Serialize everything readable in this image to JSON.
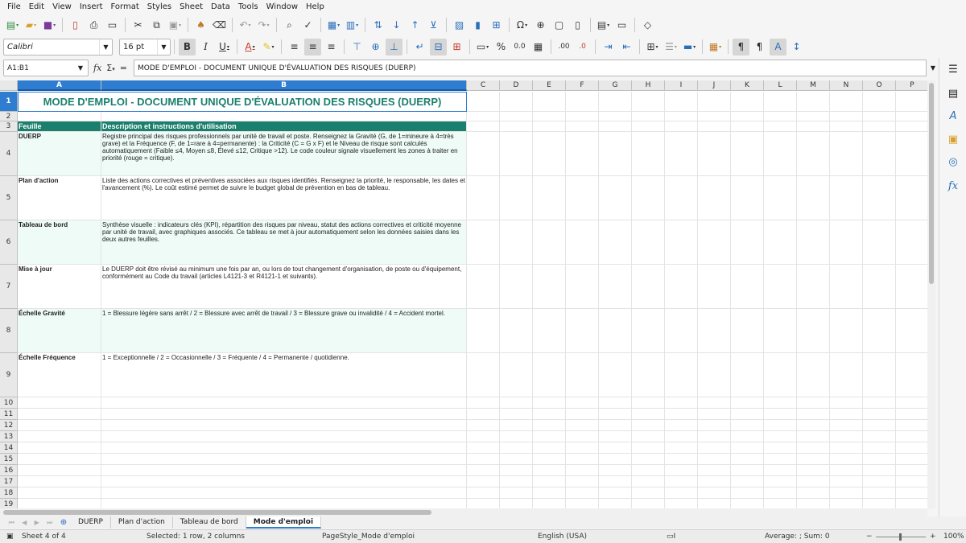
{
  "menu": [
    "File",
    "Edit",
    "View",
    "Insert",
    "Format",
    "Styles",
    "Sheet",
    "Data",
    "Tools",
    "Window",
    "Help"
  ],
  "toolbar2": {
    "font_name": "Calibri",
    "font_size": "16 pt"
  },
  "formula": {
    "name_box": "A1:B1",
    "content": "MODE D'EMPLOI - DOCUMENT UNIQUE D'ÉVALUATION DES RISQUES (DUERP)"
  },
  "columns": [
    "A",
    "B",
    "C",
    "D",
    "E",
    "F",
    "G",
    "H",
    "I",
    "J",
    "K",
    "L",
    "M",
    "N",
    "O",
    "P"
  ],
  "rows": [
    "1",
    "2",
    "3",
    "4",
    "5",
    "6",
    "7",
    "8",
    "9",
    "10",
    "11",
    "12",
    "13",
    "14",
    "15",
    "16",
    "17",
    "18",
    "19"
  ],
  "sheet": {
    "title": "MODE D'EMPLOI - DOCUMENT UNIQUE D'ÉVALUATION DES RISQUES (DUERP)",
    "header": {
      "col_a": "Feuille",
      "col_b": "Description et instructions d'utilisation"
    },
    "entries": [
      {
        "name": "DUERP",
        "desc": "Registre principal des risques professionnels par unité de travail et poste. Renseignez la Gravité (G, de 1=mineure à 4=très grave) et la Fréquence (F, de 1=rare à 4=permanente) : la Criticité (C = G x F) et le Niveau de risque sont calculés automatiquement (Faible ≤4, Moyen ≤8, Élevé ≤12, Critique >12). Le code couleur signale visuellement les zones à traiter en priorité (rouge = critique)."
      },
      {
        "name": "Plan d'action",
        "desc": "Liste des actions correctives et préventives associées aux risques identifiés. Renseignez la priorité, le responsable, les dates et l'avancement (%). Le coût estimé permet de suivre le budget global de prévention en bas de tableau."
      },
      {
        "name": "Tableau de bord",
        "desc": "Synthèse visuelle : indicateurs clés (KPI), répartition des risques par niveau, statut des actions correctives et criticité moyenne par unité de travail, avec graphiques associés. Ce tableau se met à jour automatiquement selon les données saisies dans les deux autres feuilles."
      },
      {
        "name": "Mise à jour",
        "desc": "Le DUERP doit être révisé au minimum une fois par an, ou lors de tout changement d'organisation, de poste ou d'équipement, conformément au Code du travail (articles L4121-3 et R4121-1 et suivants)."
      },
      {
        "name": "Échelle Gravité",
        "desc": "1 = Blessure légère sans arrêt / 2 = Blessure avec arrêt de travail / 3 = Blessure grave ou invalidité / 4 = Accident mortel."
      },
      {
        "name": "Échelle Fréquence",
        "desc": "1 = Exceptionnelle / 2 = Occasionnelle / 3 = Fréquente / 4 = Permanente / quotidienne."
      }
    ]
  },
  "tabs": [
    "DUERP",
    "Plan d'action",
    "Tableau de bord",
    "Mode d'emploi"
  ],
  "active_tab": "Mode d'emploi",
  "status": {
    "sheet": "Sheet 4 of 4",
    "selection": "Selected: 1 row, 2 columns",
    "page_style": "PageStyle_Mode d'emploi",
    "language": "English (USA)",
    "summary": "Average: ; Sum: 0",
    "zoom": "100%"
  },
  "colors": {
    "teal_header": "#1a7f6d",
    "mint_row": "#eefbf7",
    "selection_blue": "#2f7dd1"
  }
}
